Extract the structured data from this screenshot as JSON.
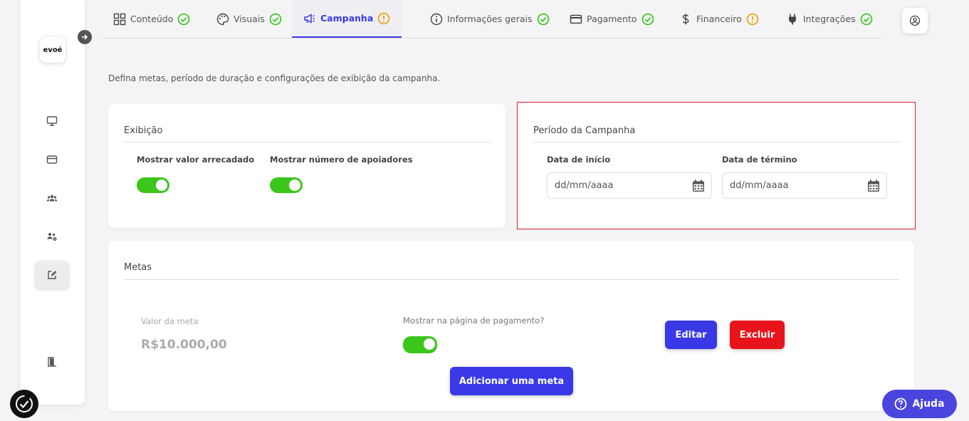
{
  "brand": {
    "logo_text": "evoé",
    "accent": "#3a39e8"
  },
  "tabs": [
    {
      "label": "Conteúdo",
      "icon": "grid-icon",
      "status": "ok"
    },
    {
      "label": "Visuais",
      "icon": "palette-icon",
      "status": "ok"
    },
    {
      "label": "Campanha",
      "icon": "megaphone-icon",
      "status": "warning",
      "active": true
    },
    {
      "label": "Informações gerais",
      "icon": "info-icon",
      "status": "ok"
    },
    {
      "label": "Pagamento",
      "icon": "card-icon",
      "status": "ok"
    },
    {
      "label": "Financeiro",
      "icon": "dollar-icon",
      "status": "warning"
    },
    {
      "label": "Integrações",
      "icon": "plug-icon",
      "status": "ok"
    }
  ],
  "description": "Defina metas, período de duração e configurações de exibição da campanha.",
  "exibicao": {
    "title": "Exibição",
    "show_raised_label": "Mostrar valor arrecadado",
    "show_raised": true,
    "show_supporters_label": "Mostrar número de apoiadores",
    "show_supporters": true
  },
  "periodo": {
    "title": "Período da Campanha",
    "start_label": "Data de início",
    "start_placeholder": "dd/mm/aaaa",
    "end_label": "Data de término",
    "end_placeholder": "dd/mm/aaaa"
  },
  "metas": {
    "title": "Metas",
    "goal_label": "Valor da meta",
    "goal_value": "R$10.000,00",
    "show_on_payment_label": "Mostrar na página de pagamento?",
    "show_on_payment": true,
    "edit_label": "Editar",
    "delete_label": "Excluir",
    "add_label": "Adicionar uma meta"
  },
  "help": {
    "label": "Ajuda"
  },
  "colors": {
    "primary": "#3a39e8",
    "danger": "#e8141b",
    "toggle_on": "#3bc61c",
    "ok": "#3bc61c",
    "warning": "#f2a00c"
  }
}
